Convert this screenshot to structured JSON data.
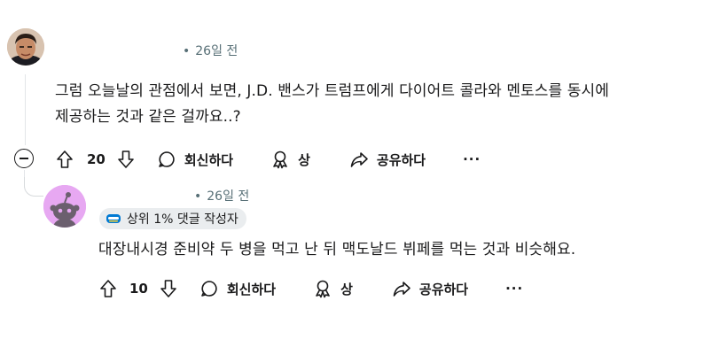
{
  "comments": [
    {
      "timestamp": "26일 전",
      "body_line1": "그럼 오늘날의 관점에서 보면, J.D. 밴스가 트럼프에게 다이어트 콜라와 멘토스를 동시에",
      "body_line2": "제공하는 것과 같은 걸까요..?",
      "votes": "20",
      "reply_label": "회신하다",
      "award_label": "상",
      "share_label": "공유하다",
      "more_label": "..."
    },
    {
      "timestamp": "26일 전",
      "flair": "상위 1% 댓글 작성자",
      "body": "대장내시경 준비약 두 병을 먹고 난 뒤 맥도날드 뷔페를 먹는 것과 비슷해요.",
      "votes": "10",
      "reply_label": "회신하다",
      "award_label": "상",
      "share_label": "공유하다",
      "more_label": "..."
    }
  ],
  "colors": {
    "text": "#1a1a1b",
    "meta": "#576f76",
    "avatar2_bg": "#e7a8f2",
    "flair_bg": "#eaedef",
    "thread_line": "#e2e5e8"
  },
  "icons": [
    "user-avatar-photo",
    "snoo-avatar",
    "upvote-icon",
    "downvote-icon",
    "comment-icon",
    "award-icon",
    "share-icon",
    "more-icon",
    "collapse-icon",
    "top-commenter-icon"
  ]
}
